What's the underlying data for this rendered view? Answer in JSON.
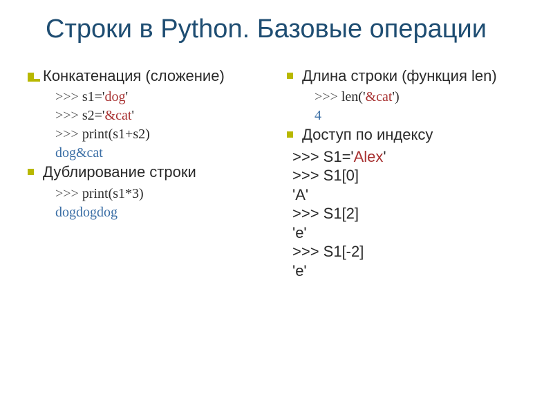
{
  "title": "Строки в Python. Базовые операции",
  "left": {
    "section1": "Конкатенация (сложение)",
    "code1a_prompt": ">>> ",
    "code1a_text": "s1='",
    "code1a_val": "dog",
    "code1a_close": "'",
    "code1b_prompt": ">>> ",
    "code1b_text": "s2='",
    "code1b_val": "&cat",
    "code1b_close": "'",
    "code1c_prompt": ">>> ",
    "code1c_text": "print(s1+s2)",
    "output1": "dog&cat",
    "section2": "Дублирование строки",
    "code2a_prompt": ">>> ",
    "code2a_text": "print(s1*3)",
    "output2": "dogdogdog"
  },
  "right": {
    "section1": "Длина строки (функция len)",
    "code1a_prompt": ">>> ",
    "code1a_text": "len('",
    "code1a_val": "&cat",
    "code1a_close": "')",
    "output1": "4",
    "section2": "Доступ по индексу",
    "line1_prompt": ">>> ",
    "line1_text": "S1='",
    "line1_val": "Alex",
    "line1_close": "'",
    "line2_prompt": ">>> ",
    "line2_text": "S1[0]",
    "line3": "'A'",
    "line4_prompt": ">>> ",
    "line4_text": "S1[2]",
    "line5": "'e'",
    "line6_prompt": ">>> ",
    "line6_text": "S1[-2]",
    "line7": "'e'"
  }
}
